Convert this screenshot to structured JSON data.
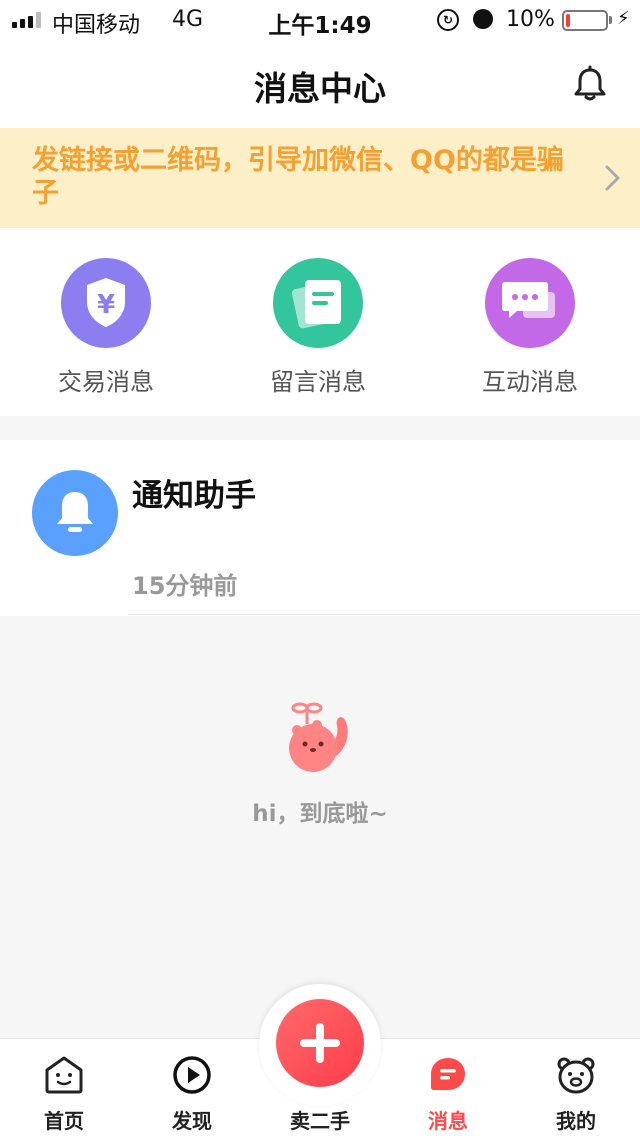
{
  "status_bar": {
    "carrier": "中国移动",
    "network": "4G",
    "time": "上午1:49",
    "battery_percent": "10%",
    "battery_level": 0.1,
    "icons": [
      "signal-icon",
      "orientation-lock-icon",
      "alarm-icon",
      "battery-icon",
      "charging-bolt-icon"
    ]
  },
  "header": {
    "title": "消息中心",
    "bell_icon": "bell-icon"
  },
  "notice": {
    "text": "发链接或二维码，引导加微信、QQ的都是骗子",
    "chevron_icon": "chevron-right-icon",
    "color": "#f5a030",
    "background": "#fdf0c8"
  },
  "categories": [
    {
      "label": "交易消息",
      "icon": "yuan-shield-icon",
      "color": "#8c7ef0"
    },
    {
      "label": "留言消息",
      "icon": "notes-icon",
      "color": "#33c59b"
    },
    {
      "label": "互动消息",
      "icon": "chat-bubbles-icon",
      "color": "#c368e6"
    }
  ],
  "notifications": [
    {
      "title": "通知助手",
      "time": "15分钟前",
      "icon": "bell-icon",
      "color": "#5aa0ff"
    }
  ],
  "end_text": "hi，到底啦~",
  "tabs": [
    {
      "label": "首页",
      "icon": "home-face-icon",
      "active": false
    },
    {
      "label": "发现",
      "icon": "play-circle-icon",
      "active": false
    },
    {
      "label": "卖二手",
      "icon": "plus-icon",
      "active": false
    },
    {
      "label": "消息",
      "icon": "message-icon",
      "active": true
    },
    {
      "label": "我的",
      "icon": "bear-face-icon",
      "active": false
    }
  ],
  "accent_color": "#ff4a4a"
}
